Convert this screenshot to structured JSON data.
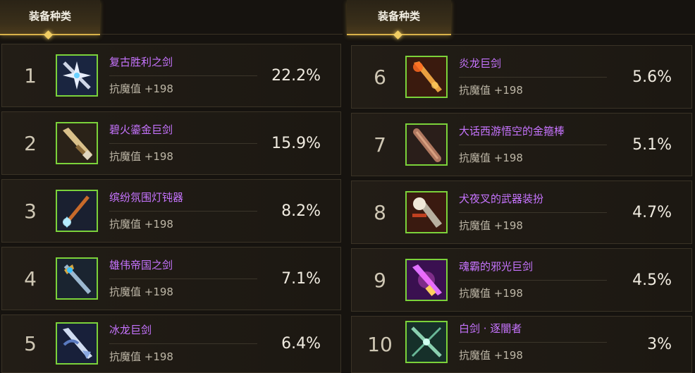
{
  "left": {
    "header": "装备种类",
    "rows": [
      {
        "rank": "1",
        "name": "复古胜利之剑",
        "stat": "抗魔值 +198",
        "percent": "22.2%",
        "icon": "star-sword-icon"
      },
      {
        "rank": "2",
        "name": "碧火鎏金巨剑",
        "stat": "抗魔值 +198",
        "percent": "15.9%",
        "icon": "golden-sword-icon"
      },
      {
        "rank": "3",
        "name": "缤纷氛围灯钝器",
        "stat": "抗魔值 +198",
        "percent": "8.2%",
        "icon": "lamp-mace-icon"
      },
      {
        "rank": "4",
        "name": "雄伟帝国之剑",
        "stat": "抗魔值 +198",
        "percent": "7.1%",
        "icon": "empire-sword-icon"
      },
      {
        "rank": "5",
        "name": "冰龙巨剑",
        "stat": "抗魔值 +198",
        "percent": "6.4%",
        "icon": "ice-dragon-sword-icon"
      }
    ]
  },
  "right": {
    "header": "装备种类",
    "rows": [
      {
        "rank": "6",
        "name": "炎龙巨剑",
        "stat": "抗魔值 +198",
        "percent": "5.6%",
        "icon": "flame-dragon-sword-icon"
      },
      {
        "rank": "7",
        "name": "大话西游悟空的金箍棒",
        "stat": "抗魔值 +198",
        "percent": "5.1%",
        "icon": "golden-staff-icon"
      },
      {
        "rank": "8",
        "name": "犬夜叉的武器装扮",
        "stat": "抗魔值 +198",
        "percent": "4.7%",
        "icon": "fang-sword-icon"
      },
      {
        "rank": "9",
        "name": "魂霸的邪光巨剑",
        "stat": "抗魔值 +198",
        "percent": "4.5%",
        "icon": "evil-light-sword-icon"
      },
      {
        "rank": "10",
        "name": "白剑 · 逐闇者",
        "stat": "抗魔值 +198",
        "percent": "3%",
        "icon": "white-sword-icon"
      }
    ]
  },
  "colors": {
    "accent_gold": "#d9b24a",
    "item_name": "#c774ff",
    "icon_border": "#7bd23a"
  }
}
